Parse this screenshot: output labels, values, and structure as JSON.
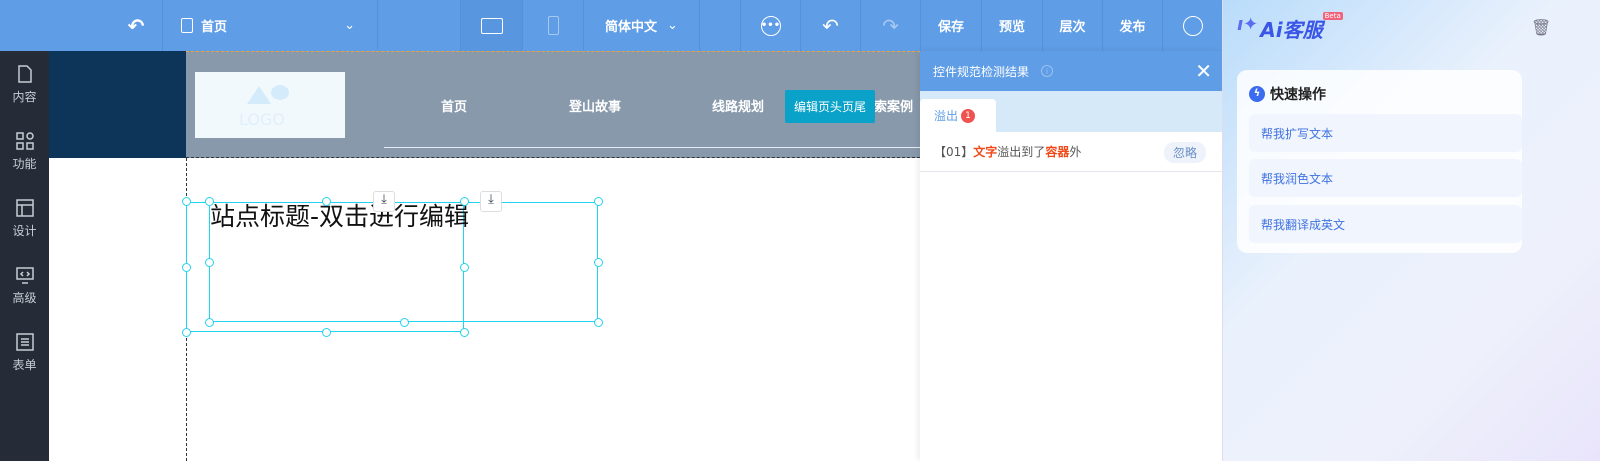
{
  "toolbar": {
    "page_select": "首页",
    "language": "简体中文",
    "save": "保存",
    "preview": "预览",
    "layers": "层次",
    "publish": "发布"
  },
  "sidebar": {
    "items": [
      {
        "label": "内容"
      },
      {
        "label": "功能"
      },
      {
        "label": "设计"
      },
      {
        "label": "高级"
      },
      {
        "label": "表单"
      }
    ]
  },
  "site_header": {
    "logo": "LOGO",
    "nav": [
      "首页",
      "登山故事",
      "线路规划",
      "索案例"
    ],
    "edit_button": "编辑页头页尾"
  },
  "canvas": {
    "title_text": "站点标题-双击进行编辑"
  },
  "check_panel": {
    "title": "控件规范检测结果",
    "tab": "溢出",
    "tab_count": "1",
    "issue": {
      "index": "【01】",
      "part1": "文字",
      "part2": "溢出到了",
      "part3": "容器",
      "part4": "外"
    },
    "ignore": "忽略"
  },
  "ai_panel": {
    "logo": "Ai客服",
    "badge": "Beta",
    "section_title": "快速操作",
    "actions": [
      "帮我扩写文本",
      "帮我润色文本",
      "帮我翻译成英文"
    ]
  },
  "colors": {
    "topbar": "#5f9de6",
    "accent_red": "#f04a1a",
    "edit_button": "#0aa2c9"
  }
}
